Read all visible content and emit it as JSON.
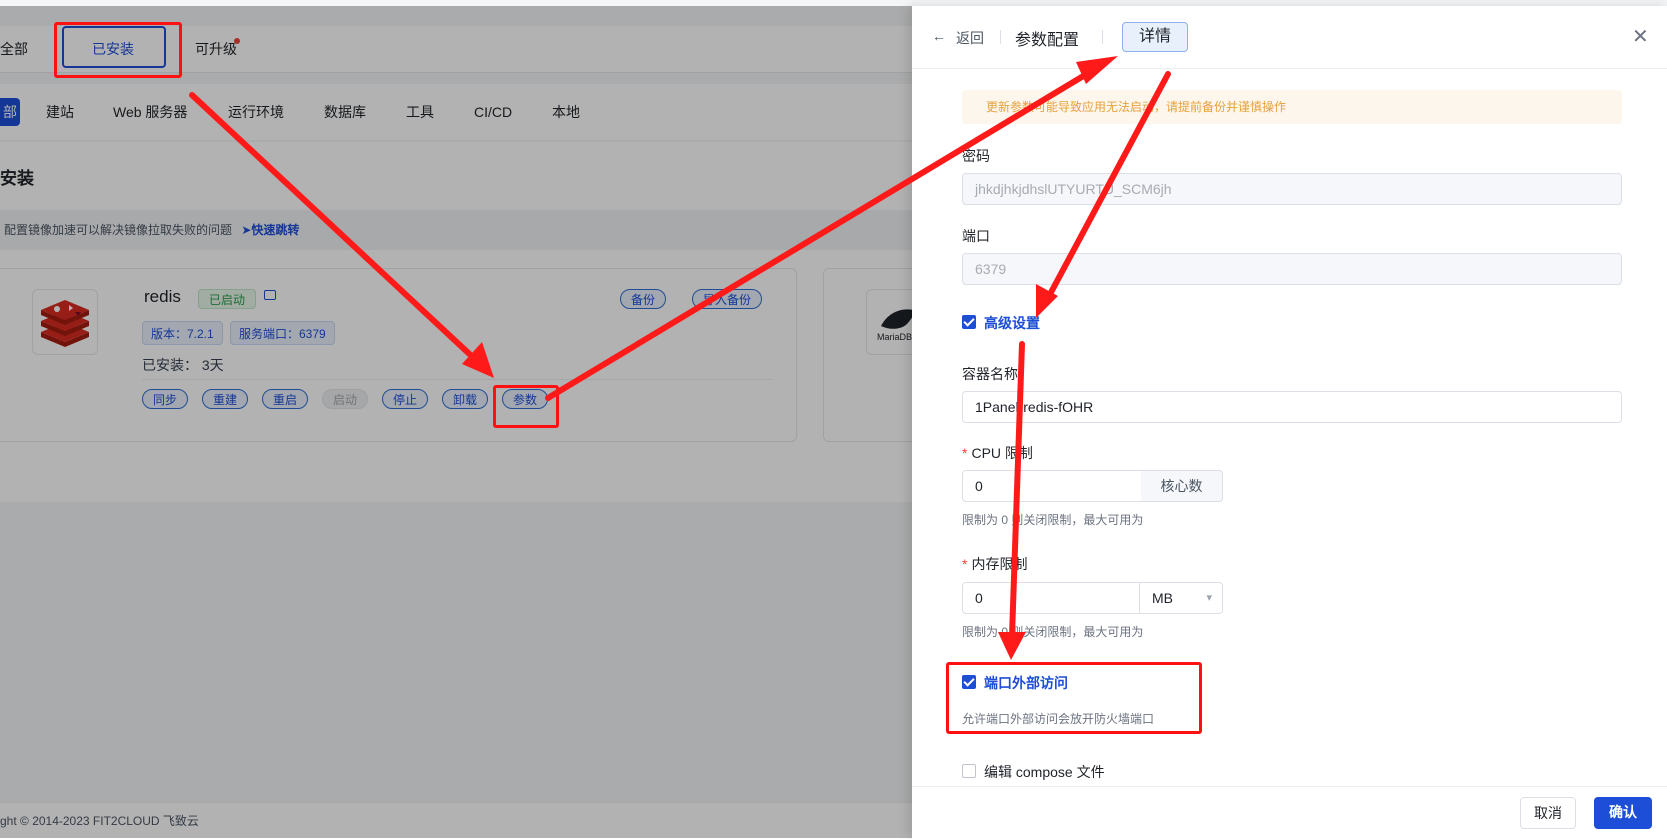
{
  "bg": {
    "tabs": [
      "全部",
      "已安装",
      "可升级"
    ],
    "categories": [
      "部",
      "建站",
      "Web 服务器",
      "运行环境",
      "数据库",
      "工具",
      "CI/CD",
      "本地"
    ],
    "section_title": "安装",
    "hint": "配置镜像加速可以解决镜像拉取失败的问题",
    "hint_link": "快速跳转",
    "app": {
      "name": "redis",
      "status": "已启动",
      "version_tag": "版本：7.2.1",
      "port_tag": "服务端口：6379",
      "installed": "已安装：  3天",
      "backup": "备份",
      "import_backup": "导入备份",
      "actions": [
        "同步",
        "重建",
        "重启",
        "启动",
        "停止",
        "卸载",
        "参数"
      ]
    },
    "card2_logo_text": "MariaDB",
    "footer": "ght © 2014-2023 FIT2CLOUD 飞致云"
  },
  "drawer": {
    "back": "返回",
    "title": "参数配置",
    "detail": "详情",
    "warning": "更新参数可能导致应用无法启动，请提前备份并谨慎操作",
    "password_label": "密码",
    "password_value": "jhkdjhkjdhslUTYURTU_SCM6jh",
    "port_label": "端口",
    "port_value": "6379",
    "advanced_label": "高级设置",
    "container_label": "容器名称",
    "container_value": "1Panel-redis-fOHR",
    "cpu_label": "CPU 限制",
    "cpu_value": "0",
    "cpu_unit": "核心数",
    "cpu_help": "限制为 0 则关闭限制，最大可用为",
    "mem_label": "内存限制",
    "mem_value": "0",
    "mem_unit": "MB",
    "mem_help": "限制为 0 则关闭限制，最大可用为",
    "external_label": "端口外部访问",
    "external_help": "允许端口外部访问会放开防火墙端口",
    "compose_label": "编辑 compose 文件",
    "cancel": "取消",
    "confirm": "确认"
  },
  "colors": {
    "primary": "#1d4ed8",
    "annotation": "#ff1a1a",
    "warning_bg": "#fdf6ec",
    "warning_text": "#e6a23c"
  }
}
